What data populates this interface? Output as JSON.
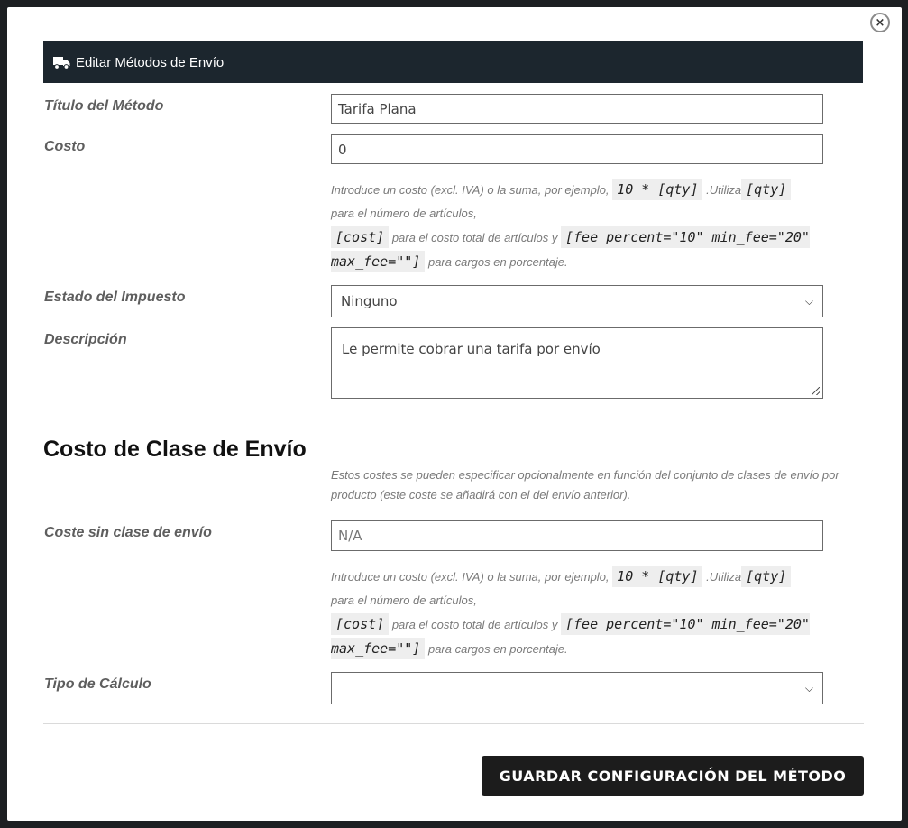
{
  "modal": {
    "title": "Editar Métodos de Envío",
    "close_label": "×"
  },
  "form": {
    "method_title": {
      "label": "Título del Método",
      "value": "Tarifa Plana"
    },
    "cost": {
      "label": "Costo",
      "value": "0",
      "help": {
        "p1": "Introduce un costo (excl. IVA) o la suma, por ejemplo,",
        "c1": "10 * [qty]",
        "p2": ".Utiliza",
        "c2": "[qty]",
        "p3": "para el número de artículos,",
        "c3": "[cost]",
        "p4": "para el costo total de artículos y",
        "c4": "[fee percent=\"10\" min_fee=\"20\" max_fee=\"\"]",
        "p5": "para cargos en porcentaje."
      }
    },
    "tax_status": {
      "label": "Estado del Impuesto",
      "selected": "Ninguno"
    },
    "description": {
      "label": "Descripción",
      "value": "Le permite cobrar una tarifa por envío"
    }
  },
  "shipping_class": {
    "title": "Costo de Clase de Envío",
    "description": "Estos costes se pueden especificar opcionalmente en función del conjunto de clases de envío por producto (este coste se añadirá con el del envío anterior).",
    "no_class_cost": {
      "label": "Coste sin clase de envío",
      "placeholder": "N/A",
      "help": {
        "p1": "Introduce un costo (excl. IVA) o la suma, por ejemplo,",
        "c1": "10 * [qty]",
        "p2": ".Utiliza",
        "c2": "[qty]",
        "p3": "para el número de artículos,",
        "c3": "[cost]",
        "p4": "para el costo total de artículos y",
        "c4": "[fee percent=\"10\" min_fee=\"20\" max_fee=\"\"]",
        "p5": "para cargos en porcentaje."
      }
    },
    "calc_type": {
      "label": "Tipo de Cálculo",
      "selected": ""
    }
  },
  "actions": {
    "save_label": "GUARDAR CONFIGURACIÓN DEL MÉTODO"
  },
  "icons": {
    "header": "truck-icon",
    "close": "close-icon",
    "select": "chevron-down-icon"
  }
}
